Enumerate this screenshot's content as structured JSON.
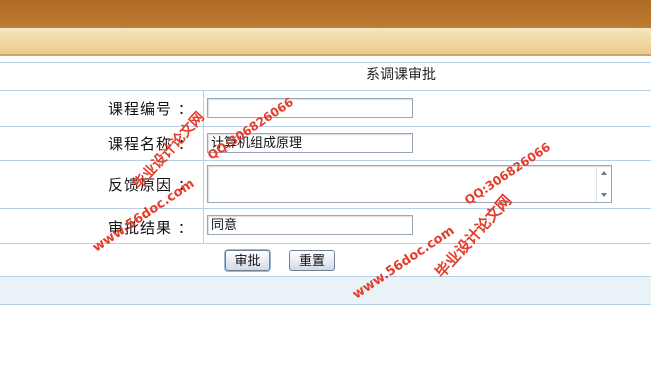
{
  "form": {
    "title": "系调课审批",
    "fields": [
      {
        "label": "课程编号",
        "colon": "：",
        "value": ""
      },
      {
        "label": "课程名称",
        "colon": "：",
        "value": "计算机组成原理"
      },
      {
        "label": "反馈原因",
        "colon": "：",
        "value": ""
      },
      {
        "label": "审批结果",
        "colon": "：",
        "value": "同意"
      }
    ],
    "buttons": {
      "approve": "审批",
      "reset": "重置"
    }
  },
  "watermark": {
    "site": "www.56doc.com",
    "qq": "QQ:306826066",
    "name": "毕业设计论文网"
  },
  "colors": {
    "header_brown": "#b06a22",
    "header_tan": "#f1d9a6",
    "grid_line": "#b9cfe6",
    "footer_band": "#e9f3f7",
    "watermark_red": "#e43d2b"
  }
}
